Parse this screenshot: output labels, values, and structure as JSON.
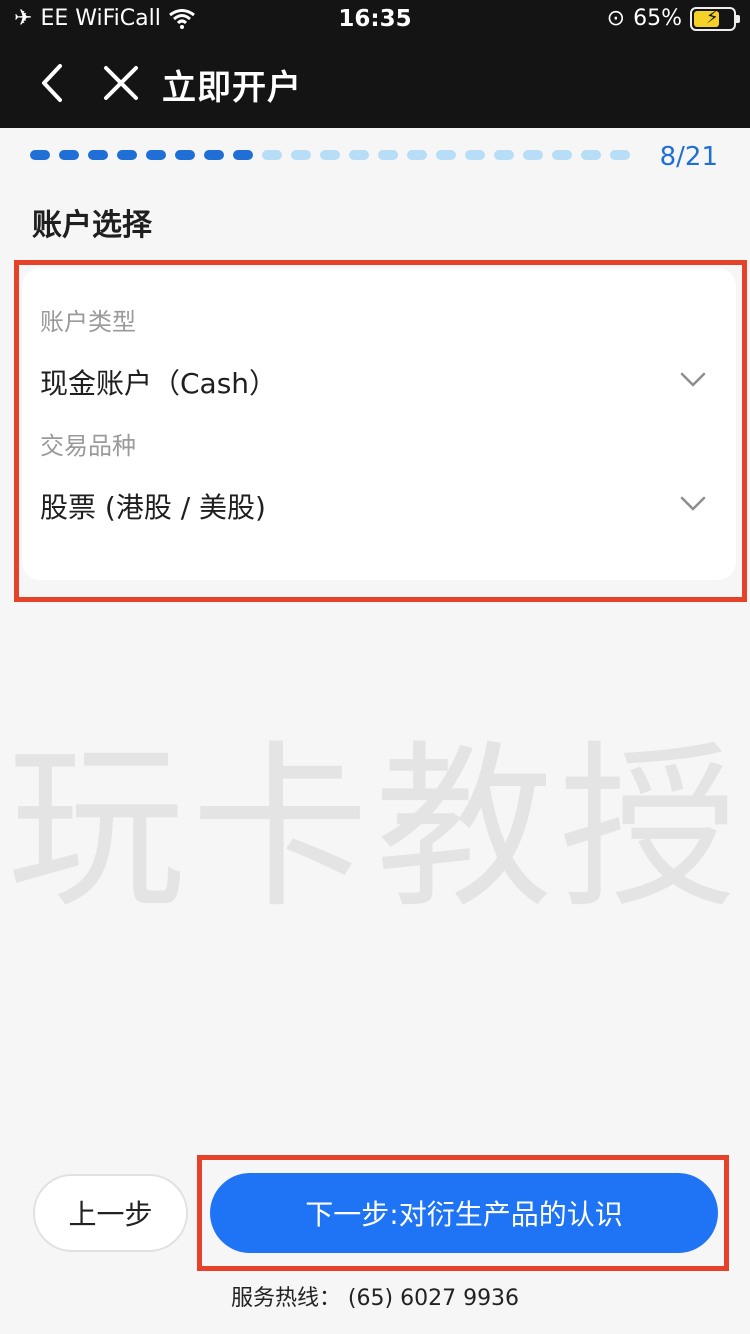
{
  "status_bar": {
    "carrier": "EE WiFiCall",
    "time": "16:35",
    "battery": "65%",
    "battery_level": 0.65
  },
  "nav": {
    "title": "立即开户",
    "back_icon": "chevron-left-icon",
    "close_icon": "close-icon"
  },
  "progress": {
    "current": 8,
    "total": 21,
    "label": "8/21",
    "active_color": "#1f6fd6",
    "inactive_color": "#b7ddf7"
  },
  "section": {
    "title": "账户选择"
  },
  "form": {
    "account_type": {
      "label": "账户类型",
      "value": "现金账户（Cash）"
    },
    "product": {
      "label": "交易品种",
      "value": "股票 (港股 / 美股)"
    }
  },
  "watermark": "玩卡教授",
  "buttons": {
    "prev_label": "上一步",
    "next_label": "下一步:对衍生产品的认识",
    "primary_color": "#1f74f5"
  },
  "footer": {
    "hotline": "服务热线：  (65) 6027 9936"
  },
  "highlight_color": "#e64129"
}
